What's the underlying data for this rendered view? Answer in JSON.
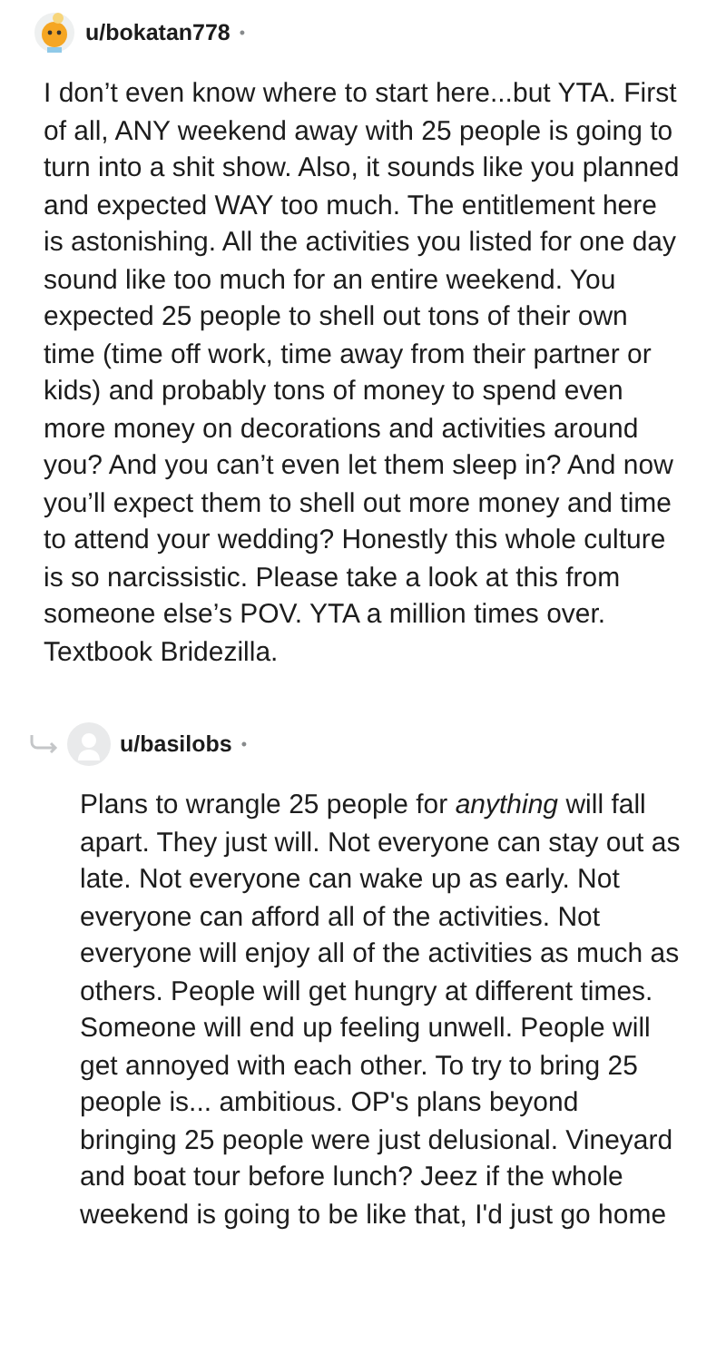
{
  "comments": [
    {
      "username": "u/bokatan778",
      "separator": "•",
      "reply": false,
      "body": "I don’t even know where to start here...but YTA. First of all, ANY weekend away with 25 people is going to turn into a shit show. Also, it sounds like you planned and expected WAY too much. The entitlement here is astonishing. All the activities you listed for one day sound like too much for an entire weekend. You expected 25 people to shell out tons of their own time (time off work, time away from their partner or kids) and probably tons of money to spend even more money on decorations and activities around you? And you can’t even let them sleep in? And now you’ll expect them to shell out more money and time to attend your wedding? Honestly this whole culture is so narcissistic. Please take a look at this from someone else’s POV. YTA a million times over. Textbook Bridezilla."
    },
    {
      "username": "u/basilobs",
      "separator": "•",
      "reply": true,
      "body": "Plans to wrangle 25 people for *anything* will fall apart. They just will. Not everyone can stay out as late. Not everyone can wake up as early. Not everyone can afford all of the activities. Not everyone will enjoy all of the activities as much as others. People will get hungry at different times. Someone will end up feeling unwell. People will get annoyed with each other. To try to bring 25 people is... ambitious. OP's plans beyond bringing 25 people were just delusional. Vineyard and boat tour before lunch? Jeez if the whole weekend is going to be like that, I'd just go home"
    }
  ]
}
